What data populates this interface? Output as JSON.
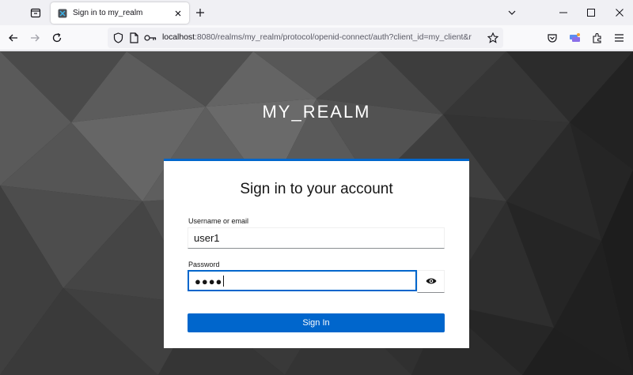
{
  "browser": {
    "tab_title": "Sign in to my_realm",
    "url_host": "localhost",
    "url_rest": ":8080/realms/my_realm/protocol/openid-connect/auth?client_id=my_client&r"
  },
  "page": {
    "realm_name": "MY_REALM",
    "form_title": "Sign in to your account",
    "username_label": "Username or email",
    "username_value": "user1",
    "password_label": "Password",
    "password_masked": "●●●●",
    "submit_label": "Sign In"
  },
  "colors": {
    "primary": "#0066cc",
    "background": "#2b2b2b"
  }
}
